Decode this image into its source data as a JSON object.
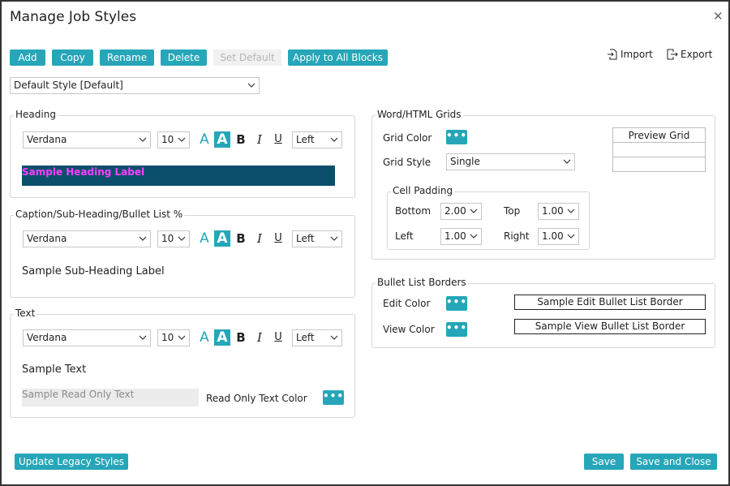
{
  "dialog": {
    "title": "Manage Job Styles"
  },
  "toolbar": {
    "add": "Add",
    "copy": "Copy",
    "rename": "Rename",
    "delete": "Delete",
    "set_default": "Set Default",
    "apply_all": "Apply to All Blocks",
    "import": "Import",
    "export": "Export"
  },
  "style_select": {
    "value": "Default Style [Default]"
  },
  "heading": {
    "title": "Heading",
    "font": "Verdana",
    "size": "10",
    "align": "Left",
    "sample": "Sample Heading Label",
    "sample_bg": "#0b4f6c",
    "sample_color": "#ff3fff"
  },
  "caption": {
    "title": "Caption/Sub-Heading/Bullet List %",
    "font": "Verdana",
    "size": "10",
    "align": "Left",
    "sample": "Sample Sub-Heading Label"
  },
  "text": {
    "title": "Text",
    "font": "Verdana",
    "size": "10",
    "align": "Left",
    "sample": "Sample Text",
    "readonly_sample": "Sample Read Only Text",
    "readonly_color_label": "Read Only Text Color"
  },
  "format_buttons": {
    "a_plain": "A",
    "a_filled": "A",
    "bold": "B",
    "italic": "I",
    "underline": "U"
  },
  "grids": {
    "title": "Word/HTML Grids",
    "grid_color_label": "Grid Color",
    "grid_style_label": "Grid Style",
    "grid_style": "Single",
    "preview": "Preview Grid",
    "cell_padding": {
      "title": "Cell Padding",
      "bottom_label": "Bottom",
      "bottom": "2.00",
      "top_label": "Top",
      "top": "1.00",
      "left_label": "Left",
      "left": "1.00",
      "right_label": "Right",
      "right": "1.00"
    }
  },
  "bullet_borders": {
    "title": "Bullet List Borders",
    "edit_label": "Edit Color",
    "view_label": "View Color",
    "edit_sample": "Sample Edit Bullet List Border",
    "view_sample": "Sample View Bullet List Border"
  },
  "dots_label": "•••",
  "footer": {
    "update_legacy": "Update Legacy Styles",
    "save": "Save",
    "save_close": "Save and Close"
  },
  "colors": {
    "accent": "#26a6b8"
  }
}
